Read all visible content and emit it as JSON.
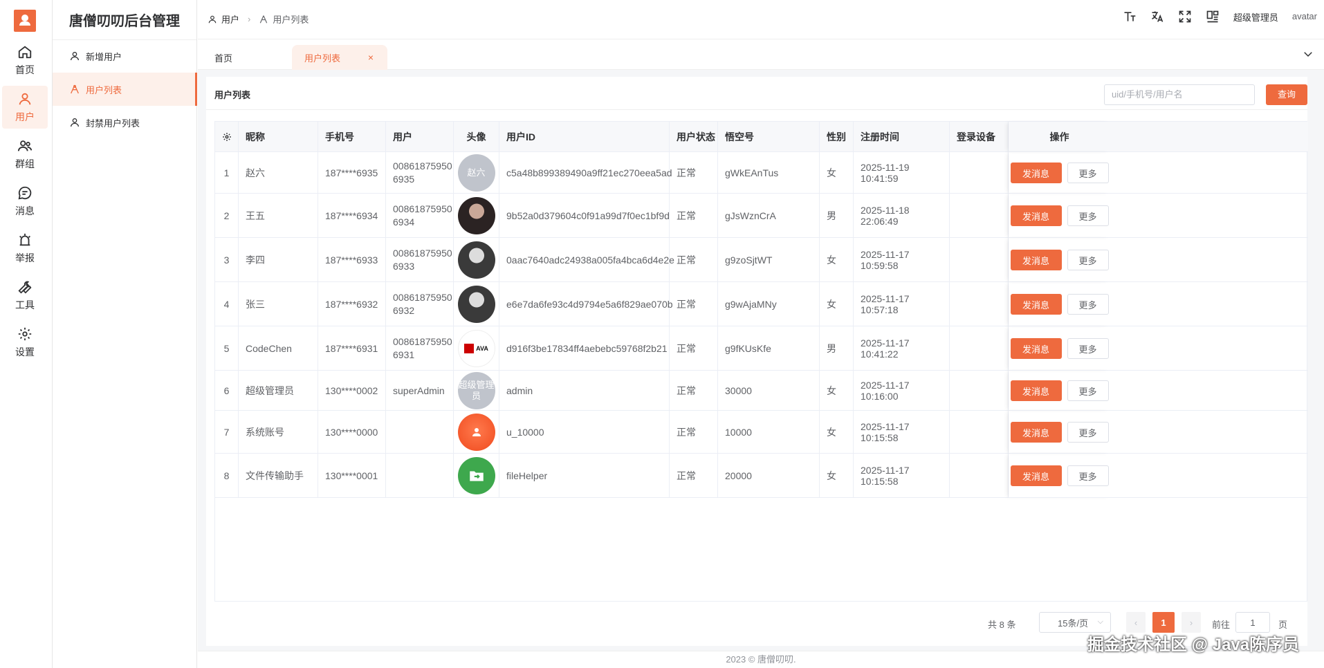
{
  "rail": {
    "items": [
      {
        "label": "首页",
        "icon": "home-icon"
      },
      {
        "label": "用户",
        "icon": "user-icon"
      },
      {
        "label": "群组",
        "icon": "group-icon"
      },
      {
        "label": "消息",
        "icon": "chat-icon"
      },
      {
        "label": "举报",
        "icon": "alarm-icon"
      },
      {
        "label": "工具",
        "icon": "wrench-icon"
      },
      {
        "label": "设置",
        "icon": "gear-icon"
      }
    ]
  },
  "submenu": {
    "title": "唐僧叨叨后台管理",
    "items": [
      {
        "label": "新增用户"
      },
      {
        "label": "用户列表"
      },
      {
        "label": "封禁用户列表"
      }
    ]
  },
  "header": {
    "breadcrumb": [
      "用户",
      "用户列表"
    ],
    "admin_name": "超级管理员",
    "avatar_alt": "avatar"
  },
  "tabs": [
    {
      "label": "首页"
    },
    {
      "label": "用户列表",
      "close": "×"
    }
  ],
  "card": {
    "title": "用户列表",
    "search_placeholder": "uid/手机号/用户名",
    "query_label": "查询"
  },
  "table": {
    "columns": [
      "昵称",
      "手机号",
      "用户",
      "头像",
      "用户ID",
      "用户状态",
      "悟空号",
      "性别",
      "注册时间",
      "登录设备",
      "操作"
    ],
    "rows": [
      {
        "idx": "1",
        "nick": "赵六",
        "phone": "187****6935",
        "user_a": "00861875950",
        "user_b": "6935",
        "avatar_text": "赵六",
        "uid": "c5a48b899389490a9ff21ec270eea5ad",
        "status": "正常",
        "wk": "gWkEAnTus",
        "sex": "女",
        "time": "2025-11-19 10:41:59",
        "device": ""
      },
      {
        "idx": "2",
        "nick": "王五",
        "phone": "187****6934",
        "user_a": "00861875950",
        "user_b": "6934",
        "avatar_text": "",
        "uid": "9b52a0d379604c0f91a99d7f0ec1bf9d",
        "status": "正常",
        "wk": "gJsWznCrA",
        "sex": "男",
        "time": "2025-11-18 22:06:49",
        "device": ""
      },
      {
        "idx": "3",
        "nick": "李四",
        "phone": "187****6933",
        "user_a": "00861875950",
        "user_b": "6933",
        "avatar_text": "",
        "uid": "0aac7640adc24938a005fa4bca6d4e2e",
        "status": "正常",
        "wk": "g9zoSjtWT",
        "sex": "女",
        "time": "2025-11-17 10:59:58",
        "device": ""
      },
      {
        "idx": "4",
        "nick": "张三",
        "phone": "187****6932",
        "user_a": "00861875950",
        "user_b": "6932",
        "avatar_text": "",
        "uid": "e6e7da6fe93c4d9794e5a6f829ae070b",
        "status": "正常",
        "wk": "g9wAjaMNy",
        "sex": "女",
        "time": "2025-11-17 10:57:18",
        "device": ""
      },
      {
        "idx": "5",
        "nick": "CodeChen",
        "phone": "187****6931",
        "user_a": "00861875950",
        "user_b": "6931",
        "avatar_text": "AVA",
        "uid": "d916f3be17834ff4aebebc59768f2b21",
        "status": "正常",
        "wk": "g9fKUsKfe",
        "sex": "男",
        "time": "2025-11-17 10:41:22",
        "device": ""
      },
      {
        "idx": "6",
        "nick": "超级管理员",
        "phone": "130****0002",
        "user_a": "superAdmin",
        "user_b": "",
        "avatar_text": "超级管理员",
        "uid": "admin",
        "status": "正常",
        "wk": "30000",
        "sex": "女",
        "time": "2025-11-17 10:16:00",
        "device": ""
      },
      {
        "idx": "7",
        "nick": "系统账号",
        "phone": "130****0000",
        "user_a": "",
        "user_b": "",
        "avatar_text": "",
        "uid": "u_10000",
        "status": "正常",
        "wk": "10000",
        "sex": "女",
        "time": "2025-11-17 10:15:58",
        "device": ""
      },
      {
        "idx": "8",
        "nick": "文件传输助手",
        "phone": "130****0001",
        "user_a": "",
        "user_b": "",
        "avatar_text": "",
        "uid": "fileHelper",
        "status": "正常",
        "wk": "20000",
        "sex": "女",
        "time": "2025-11-17 10:15:58",
        "device": ""
      }
    ],
    "send_label": "发消息",
    "more_label": "更多"
  },
  "pager": {
    "total": "共 8 条",
    "page_size": "15条/页",
    "current": "1",
    "goto_label": "前往",
    "goto_value": "1",
    "page_suffix": "页"
  },
  "footer": "2023 © 唐僧叨叨.",
  "watermark": "掘金技术社区 @ Java陈序员",
  "colors": {
    "accent": "#ee6a3e",
    "accent_bg": "#fdf0ea"
  }
}
